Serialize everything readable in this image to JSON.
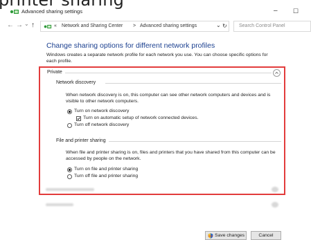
{
  "caption": {
    "text": "printer sharing"
  },
  "window": {
    "title": "Advanced sharing settings",
    "minimize_glyph": "–",
    "maximize_glyph": "☐",
    "app_icon": "network-sharing-icon"
  },
  "address_bar": {
    "back_glyph": "←",
    "forward_glyph": "→",
    "dropdown_glyph": "⌄",
    "up_glyph": "↑",
    "overflow_glyph": "«",
    "breadcrumbs": [
      "Network and Sharing Center",
      "Advanced sharing settings"
    ],
    "separator": ">",
    "dropdown_chevron": "⌄",
    "refresh_glyph": "↻",
    "search_placeholder": "Search Control Panel"
  },
  "content": {
    "heading": "Change sharing options for different network profiles",
    "intro": "Windows creates a separate network profile for each network you use. You can choose specific options for each profile."
  },
  "private_profile": {
    "label": "Private",
    "expanded_glyph": "⌃",
    "network_discovery": {
      "title": "Network discovery",
      "description": "When network discovery is on, this computer can see other network computers and devices and is visible to other network computers.",
      "options": [
        {
          "label": "Turn on network discovery",
          "selected": true
        },
        {
          "label": "Turn off network discovery",
          "selected": false
        }
      ],
      "auto_setup": {
        "label": "Turn on automatic setup of network connected devices.",
        "checked": true
      }
    },
    "file_printer_sharing": {
      "title": "File and printer sharing",
      "description": "When file and printer sharing is on, files and printers that you have shared from this computer can be accessed by people on the network.",
      "options": [
        {
          "label": "Turn on file and printer sharing",
          "selected": true
        },
        {
          "label": "Turn off file and printer sharing",
          "selected": false
        }
      ]
    }
  },
  "footer": {
    "save_label": "Save changes",
    "cancel_label": "Cancel",
    "save_icon": "shield-icon"
  }
}
